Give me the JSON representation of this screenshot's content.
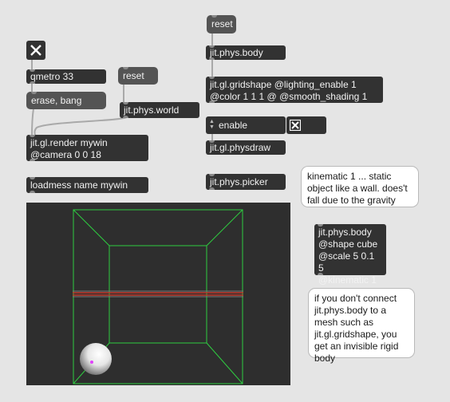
{
  "patcher": {
    "reset_top": "reset",
    "jit_phys_body_top": "jit.phys.body",
    "gridshape_line1": "jit.gl.gridshape @lighting_enable 1",
    "gridshape_line2": "@color 1 1 1 @ @smooth_shading 1",
    "enable_label": "enable",
    "physdraw": "jit.gl.physdraw",
    "picker": "jit.phys.picker",
    "qmetro": "qmetro 33",
    "reset_left": "reset",
    "erase_bang": "erase, bang",
    "phys_world": "jit.phys.world",
    "render_line1": "jit.gl.render mywin",
    "render_line2": "@camera 0 0 18",
    "loadmess": "loadmess name mywin",
    "kinematic_comment": "kinematic 1 ... static object like a wall. does't fall due to the gravity",
    "body_cube_line1": "jit.phys.body",
    "body_cube_line2": "@shape cube",
    "body_cube_line3": "@scale 5 0.1 5",
    "body_cube_line4": "@kinematic 1",
    "invisible_comment": "if you don't connect jit.phys.body to a mesh such as jit.gl.gridshape, you get an invisible rigid body"
  },
  "colors": {
    "background": "#e5e5e5",
    "object_bg": "#323232",
    "message_bg": "#545454",
    "toggle_on": "#ffffff",
    "cord": "#a9a9a9",
    "render_bg": "#2e2e2e",
    "grid_green": "#2ecc40",
    "plane_red": "#c0392b"
  },
  "icons": {
    "toggle": "x-mark-icon",
    "enable_arrows": "up-down-arrows-icon"
  }
}
